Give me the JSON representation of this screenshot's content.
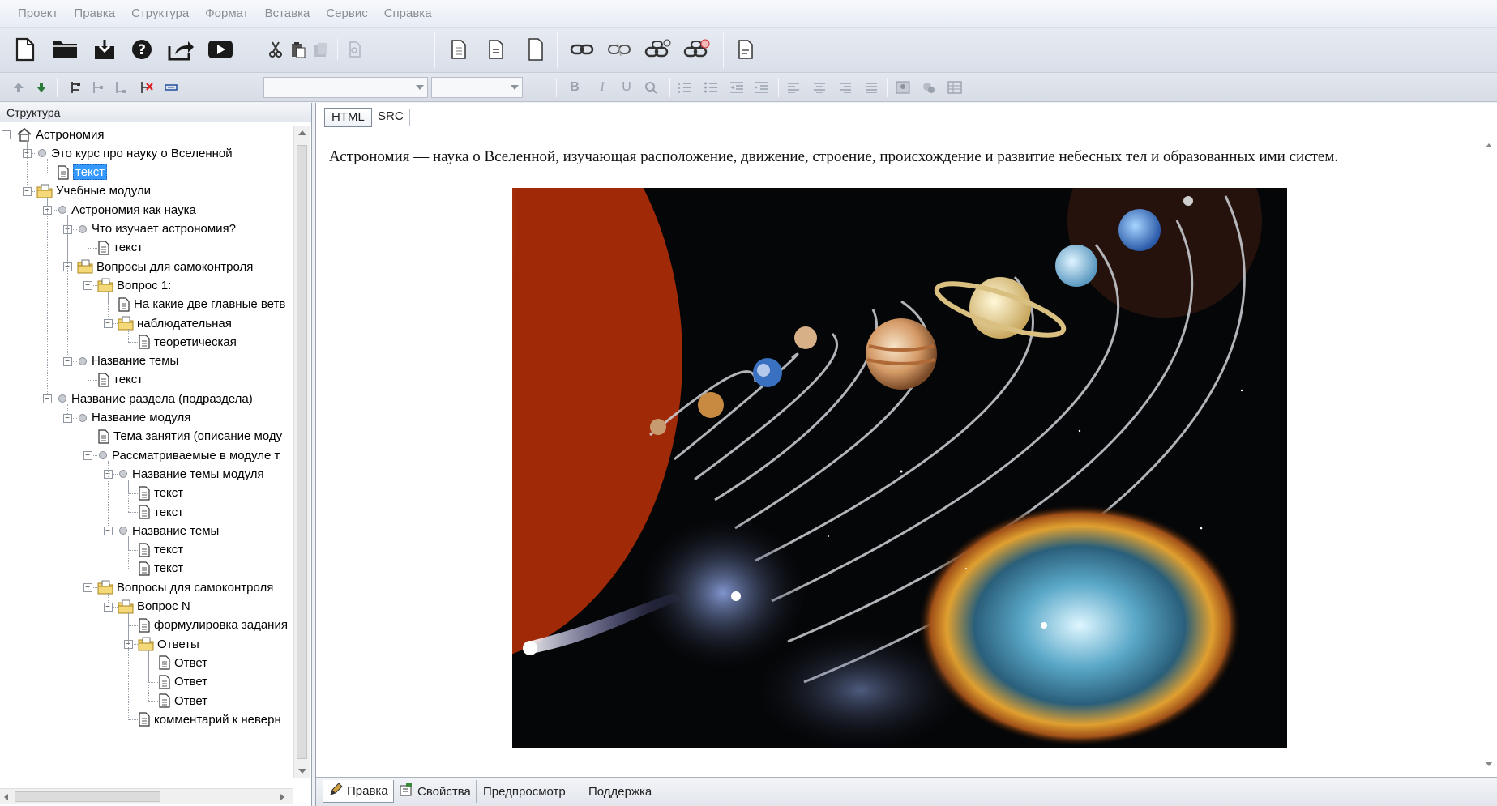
{
  "menu": [
    "Проект",
    "Правка",
    "Структура",
    "Формат",
    "Вставка",
    "Сервис",
    "Справка"
  ],
  "left_panel": {
    "title": "Структура",
    "tree": [
      {
        "label": "Астрономия",
        "depth": 0,
        "icon": "home-icon",
        "exp": "minus"
      },
      {
        "label": "Это курс про науку о Вселенной",
        "depth": 1,
        "icon": "bullet-icon",
        "exp": "minus"
      },
      {
        "label": "текст",
        "depth": 2,
        "icon": "page-icon",
        "selected": true
      },
      {
        "label": "Учебные модули",
        "depth": 1,
        "icon": "folder-icon",
        "exp": "minus"
      },
      {
        "label": "Астрономия как наука",
        "depth": 2,
        "icon": "bullet-icon",
        "exp": "minus"
      },
      {
        "label": "Что изучает астрономия?",
        "depth": 3,
        "icon": "bullet-icon",
        "exp": "minus"
      },
      {
        "label": "текст",
        "depth": 4,
        "icon": "page-icon"
      },
      {
        "label": "Вопросы для самоконтроля",
        "depth": 3,
        "icon": "folder-icon",
        "exp": "minus"
      },
      {
        "label": "Вопрос 1:",
        "depth": 4,
        "icon": "folder-icon",
        "exp": "minus"
      },
      {
        "label": "На какие две главные ветв",
        "depth": 5,
        "icon": "page-icon"
      },
      {
        "label": "наблюдательная",
        "depth": 5,
        "icon": "folder-icon",
        "exp": "minus"
      },
      {
        "label": "теоретическая",
        "depth": 6,
        "icon": "page-icon"
      },
      {
        "label": "Название темы",
        "depth": 3,
        "icon": "bullet-icon",
        "exp": "minus"
      },
      {
        "label": "текст",
        "depth": 4,
        "icon": "page-icon"
      },
      {
        "label": "Название раздела (подраздела)",
        "depth": 2,
        "icon": "bullet-icon",
        "exp": "minus"
      },
      {
        "label": "Название модуля",
        "depth": 3,
        "icon": "bullet-icon",
        "exp": "minus"
      },
      {
        "label": "Тема занятия (описание моду",
        "depth": 4,
        "icon": "page-icon"
      },
      {
        "label": "Рассматриваемые в модуле т",
        "depth": 4,
        "icon": "bullet-icon",
        "exp": "minus"
      },
      {
        "label": "Название темы модуля",
        "depth": 5,
        "icon": "bullet-icon",
        "exp": "minus"
      },
      {
        "label": "текст",
        "depth": 6,
        "icon": "page-icon"
      },
      {
        "label": "текст",
        "depth": 6,
        "icon": "page-icon"
      },
      {
        "label": "Название темы",
        "depth": 5,
        "icon": "bullet-icon",
        "exp": "minus"
      },
      {
        "label": "текст",
        "depth": 6,
        "icon": "page-icon"
      },
      {
        "label": "текст",
        "depth": 6,
        "icon": "page-icon"
      },
      {
        "label": "Вопросы для самоконтроля",
        "depth": 4,
        "icon": "folder-icon",
        "exp": "minus"
      },
      {
        "label": "Вопрос N",
        "depth": 5,
        "icon": "folder-icon",
        "exp": "minus"
      },
      {
        "label": "формулировка задания",
        "depth": 6,
        "icon": "page-icon"
      },
      {
        "label": "Ответы",
        "depth": 6,
        "icon": "folder-icon",
        "exp": "minus"
      },
      {
        "label": "Ответ",
        "depth": 7,
        "icon": "page-icon"
      },
      {
        "label": "Ответ",
        "depth": 7,
        "icon": "page-icon"
      },
      {
        "label": "Ответ",
        "depth": 7,
        "icon": "page-icon"
      },
      {
        "label": "комментарий к неверн",
        "depth": 6,
        "icon": "page-icon"
      }
    ]
  },
  "editor": {
    "view_tabs": [
      "HTML",
      "SRC"
    ],
    "active_view": "HTML",
    "paragraph": "Астрономия — наука о Вселенной, изучающая расположение, движение, строение, происхождение и развитие небесных тел и образованных ими систем.",
    "image_alt": "solar-system-image"
  },
  "bottom_tabs": [
    "Правка",
    "Свойства",
    "Предпросмотр",
    "Поддержка"
  ],
  "active_bottom_tab": "Правка",
  "colors": {
    "selection": "#3399ff",
    "toolbar": "#dde2ea",
    "menu_text": "#8a8f96"
  }
}
